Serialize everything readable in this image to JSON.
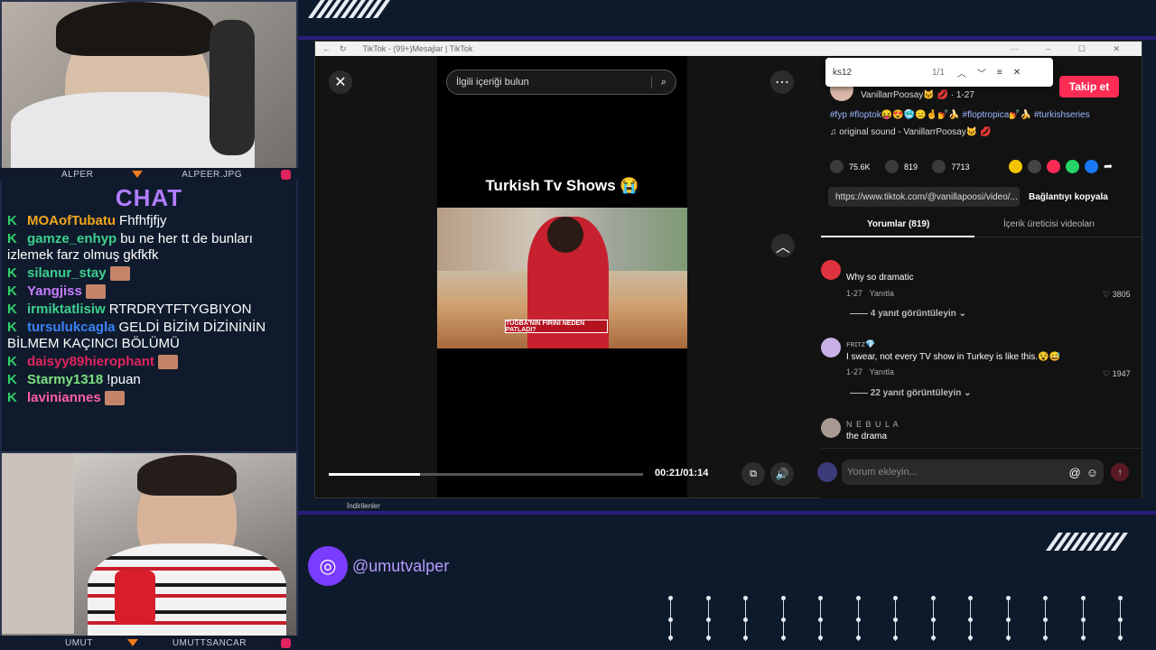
{
  "overlay": {
    "cam_top_left": "ALPER",
    "cam_top_right": "ALPEER.JPG",
    "cam_bottom_left": "UMUT",
    "cam_bottom_right": "UMUTTSANCAR",
    "chat_title": "CHAT",
    "social_handle": "@umutvalper",
    "chat": [
      {
        "user": "MOAofTubatu",
        "color": "#f2a51a",
        "text": "Fhfhfjfjy",
        "emote": false
      },
      {
        "user": "gamze_enhyp",
        "color": "#3ecf8e",
        "text": "bu ne her tt de bunları izlemek farz olmuş gkfkfk",
        "emote": false
      },
      {
        "user": "silanur_stay",
        "color": "#3ecf8e",
        "text": "",
        "emote": true
      },
      {
        "user": "Yangjiss",
        "color": "#c77dff",
        "text": "",
        "emote": true
      },
      {
        "user": "irmiktatlisiw",
        "color": "#3ecf8e",
        "text": "RTRDRYTFTYGBIYON",
        "emote": false
      },
      {
        "user": "tursulukcagla",
        "color": "#3b82f6",
        "text": "GELDİ BİZİM DİZİNİNİN BİLMEM KAÇINCI BÖLÜMÜ",
        "emote": false
      },
      {
        "user": "daisyy89hierophant",
        "color": "#e0245e",
        "text": "",
        "emote": true
      },
      {
        "user": "Starmy1318",
        "color": "#7ee07e",
        "text": "!puan",
        "emote": false
      },
      {
        "user": "laviniannes",
        "color": "#ff5fa2",
        "text": "",
        "emote": true
      }
    ]
  },
  "browser": {
    "title": "TikTok - (99+)Mesajlar | TikTok",
    "downloads_label": "İndirilenler",
    "find": {
      "query": "ks12",
      "count": "1/1"
    }
  },
  "video": {
    "search_placeholder": "İlgili içeriği bulun",
    "overlay_title": "Turkish Tv Shows 😭",
    "caption_banner": "TUĞBA'NIN FIRINI NEDEN PATLADI?",
    "progress": 0.29,
    "time": "00:21/01:14"
  },
  "post": {
    "author": "VanillarrPoosay🐱 💋 · 1-27",
    "follow_label": "Takip et",
    "hashtags": "#fyp #floptok😝😍🥶😑🤞💅🍌 #floptropica💅🍌 #turkishseries",
    "sound": "original sound - VanillarrPoosay🐱 💋",
    "likes": "75.6K",
    "comments_count": "819",
    "saves": "7713",
    "url": "https://www.tiktok.com/@vanillapoosi/video/...",
    "copy_label": "Bağlantıyı kopyala",
    "tab_comments": "Yorumlar (819)",
    "tab_creator": "İçerik üreticisi videoları",
    "comment_placeholder": "Yorum ekleyin..."
  },
  "comments": [
    {
      "author": "",
      "text": "Why so dramatic",
      "date": "1-27",
      "reply": "Yanıtla",
      "likes": "3805",
      "replies": "4 yanıt görüntüleyin",
      "avatar": "#e0333f"
    },
    {
      "author": "ꜰʀɪᴛᴢ💎",
      "text": "I swear, not every TV show in Turkey is like this.😵😅",
      "date": "1-27",
      "reply": "Yanıtla",
      "likes": "1947",
      "replies": "22 yanıt görüntüleyin",
      "avatar": "#c9b0e6"
    },
    {
      "author": "N E B U L A",
      "text": "the drama",
      "date": "",
      "reply": "",
      "likes": "",
      "replies": "",
      "avatar": "#a89a92"
    }
  ],
  "icons": [
    "close-icon",
    "more-icon",
    "search-icon",
    "chevron-up-icon",
    "volume-icon",
    "heart-icon",
    "comment-icon",
    "bookmark-icon",
    "share-icon",
    "globe-icon",
    "emoji-icon",
    "mention-icon",
    "send-icon"
  ]
}
